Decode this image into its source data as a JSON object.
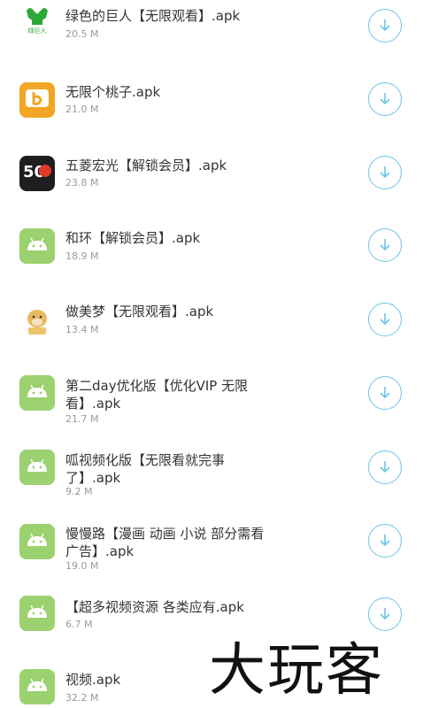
{
  "apps": [
    {
      "name": "绿色的巨人【无限观看】.apk",
      "size": "20.5 M",
      "icon": "green-giant-icon"
    },
    {
      "name": "无限个桃子.apk",
      "size": "21.0 M",
      "icon": "peach-b-icon"
    },
    {
      "name": "五菱宏光【解锁会员】.apk",
      "size": "23.8 M",
      "icon": "wuling-50-icon"
    },
    {
      "name": "和环【解锁会员】.apk",
      "size": "18.9 M",
      "icon": "android-icon"
    },
    {
      "name": "做美梦【无限观看】.apk",
      "size": "13.4 M",
      "icon": "doge-icon"
    },
    {
      "name": "第二day优化版【优化VIP 无限\n看】.apk",
      "size": "21.7 M",
      "icon": "android-icon"
    },
    {
      "name": "呱视频化版【无限看就完事\n了】.apk",
      "size": "9.2 M",
      "icon": "android-icon"
    },
    {
      "name": "慢慢路【漫画 动画 小说 部分需看\n广告】.apk",
      "size": "19.0 M",
      "icon": "android-icon"
    },
    {
      "name": "【超多视频资源 各类应有.apk",
      "size": "6.7 M",
      "icon": "android-icon"
    },
    {
      "name": "视频.apk",
      "size": "32.2 M",
      "icon": "android-icon"
    }
  ],
  "icon_labels": {
    "green_giant": "绿巨人",
    "wuling_number": "50"
  },
  "download_icon": "download-arrow-icon",
  "watermark": "大玩客",
  "colors": {
    "android_green": "#9bd16f",
    "download_blue": "#6ec4e8",
    "text": "#333333",
    "subtext": "#9a9a9a"
  }
}
